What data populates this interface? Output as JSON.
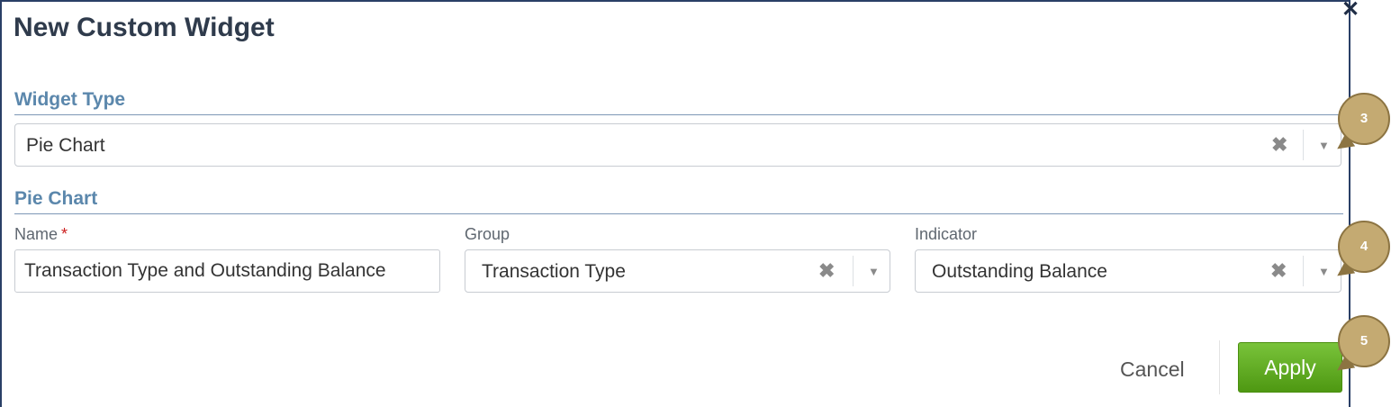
{
  "dialog": {
    "title": "New Custom Widget",
    "close_icon": "close-icon"
  },
  "widget_type": {
    "section_title": "Widget Type",
    "selected": "Pie Chart",
    "clear_glyph": "✖",
    "arrow_glyph": "▼"
  },
  "pie_chart": {
    "section_title": "Pie Chart",
    "name": {
      "label": "Name",
      "required_mark": "*",
      "value": "Transaction Type and Outstanding Balance"
    },
    "group": {
      "label": "Group",
      "selected": "Transaction Type"
    },
    "indicator": {
      "label": "Indicator",
      "selected": "Outstanding Balance"
    }
  },
  "footer": {
    "cancel_label": "Cancel",
    "apply_label": "Apply"
  },
  "callouts": [
    "3",
    "4",
    "5"
  ],
  "colors": {
    "title": "#2f3b4c",
    "section": "#5b87ac",
    "apply_green": "#5aa61b",
    "callout": "#c4aa72"
  }
}
